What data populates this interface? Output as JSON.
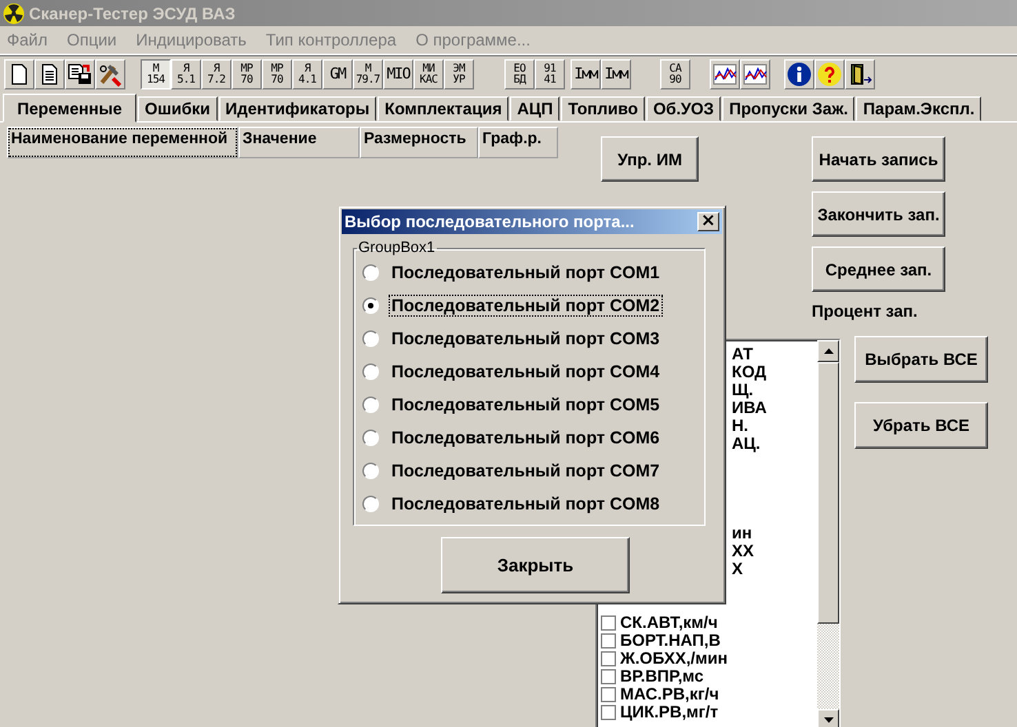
{
  "window": {
    "title": "Сканер-Тестер  ЭСУД ВАЗ"
  },
  "menu": [
    "Файл",
    "Опции",
    "Индицировать",
    "Тип контроллера",
    "О программе..."
  ],
  "toolbar": {
    "groups": [
      [
        {
          "lines": [
            "М",
            "154"
          ],
          "pressed": true
        },
        {
          "lines": [
            "Я",
            "5.1"
          ],
          "pressed": false
        },
        {
          "lines": [
            "Я",
            "7.2"
          ],
          "pressed": false
        },
        {
          "lines": [
            "МР",
            "70"
          ],
          "pressed": false
        },
        {
          "lines": [
            "МР",
            "70"
          ],
          "pressed": false
        },
        {
          "lines": [
            "Я",
            "4.1"
          ],
          "pressed": false
        },
        {
          "lines": [
            "GM"
          ],
          "pressed": false
        },
        {
          "lines": [
            "М",
            "79.7"
          ],
          "pressed": false
        },
        {
          "lines": [
            "МIО"
          ],
          "pressed": false
        },
        {
          "lines": [
            "МИ",
            "КАС"
          ],
          "pressed": false
        },
        {
          "lines": [
            "ЭМ",
            "УР"
          ],
          "pressed": false
        }
      ],
      [
        {
          "lines": [
            "ЕО",
            "БД"
          ],
          "pressed": false
        },
        {
          "lines": [
            "91",
            "41"
          ],
          "pressed": false
        }
      ],
      [
        {
          "lines": [
            "Iмм"
          ],
          "pressed": false
        },
        {
          "lines": [
            "Iмм"
          ],
          "pressed": false
        }
      ],
      [
        {
          "lines": [
            "СА",
            "90"
          ],
          "pressed": false
        }
      ]
    ]
  },
  "tabs": [
    {
      "label": "Переменные",
      "selected": true
    },
    {
      "label": "Ошибки",
      "selected": false
    },
    {
      "label": "Идентификаторы",
      "selected": false
    },
    {
      "label": "Комплектация",
      "selected": false
    },
    {
      "label": "АЦП",
      "selected": false
    },
    {
      "label": "Топливо",
      "selected": false
    },
    {
      "label": "Об.УОЗ",
      "selected": false
    },
    {
      "label": "Пропуски Заж.",
      "selected": false
    },
    {
      "label": "Парам.Экспл.",
      "selected": false
    }
  ],
  "table": {
    "columns": [
      "Наименование переменной",
      "Значение",
      "Размерность",
      "Граф.р."
    ]
  },
  "control_button": "Упр. ИМ",
  "record_buttons": [
    "Начать запись",
    "Закончить зап.",
    "Среднее зап."
  ],
  "percent_label": "Процент зап.",
  "variables_list": [
    {
      "kind": "covered",
      "text": "АТ"
    },
    {
      "kind": "covered",
      "text": "КОД"
    },
    {
      "kind": "covered",
      "text": "Щ."
    },
    {
      "kind": "covered",
      "text": "ИВА"
    },
    {
      "kind": "covered",
      "text": "Н."
    },
    {
      "kind": "covered",
      "text": "АЦ."
    },
    {
      "kind": "covered",
      "text": "ин"
    },
    {
      "kind": "covered",
      "text": "ХХ"
    },
    {
      "kind": "covered",
      "text": "Х"
    },
    {
      "kind": "checkbox",
      "text": "СК.АВТ,км/ч",
      "checked": false
    },
    {
      "kind": "checkbox",
      "text": "БОРТ.НАП,В",
      "checked": false
    },
    {
      "kind": "checkbox",
      "text": "Ж.ОБХХ,/мин",
      "checked": false
    },
    {
      "kind": "checkbox",
      "text": "ВР.ВПР,мс",
      "checked": false
    },
    {
      "kind": "checkbox",
      "text": "МАС.РВ,кг/ч",
      "checked": false
    },
    {
      "kind": "checkbox",
      "text": "ЦИК.РВ,мг/т",
      "checked": false
    }
  ],
  "select_buttons": [
    "Выбрать ВСЕ",
    "Убрать ВСЕ"
  ],
  "dialog": {
    "title": "Выбор последовательного порта...",
    "close": "×",
    "group_title": "GroupBox1",
    "options": [
      {
        "label": "Последовательный порт COM1",
        "selected": false
      },
      {
        "label": "Последовательный порт COM2",
        "selected": true
      },
      {
        "label": "Последовательный порт COM3",
        "selected": false
      },
      {
        "label": "Последовательный порт COM4",
        "selected": false
      },
      {
        "label": "Последовательный порт COM5",
        "selected": false
      },
      {
        "label": "Последовательный порт COM6",
        "selected": false
      },
      {
        "label": "Последовательный порт COM7",
        "selected": false
      },
      {
        "label": "Последовательный порт COM8",
        "selected": false
      }
    ],
    "button": "Закрыть"
  }
}
